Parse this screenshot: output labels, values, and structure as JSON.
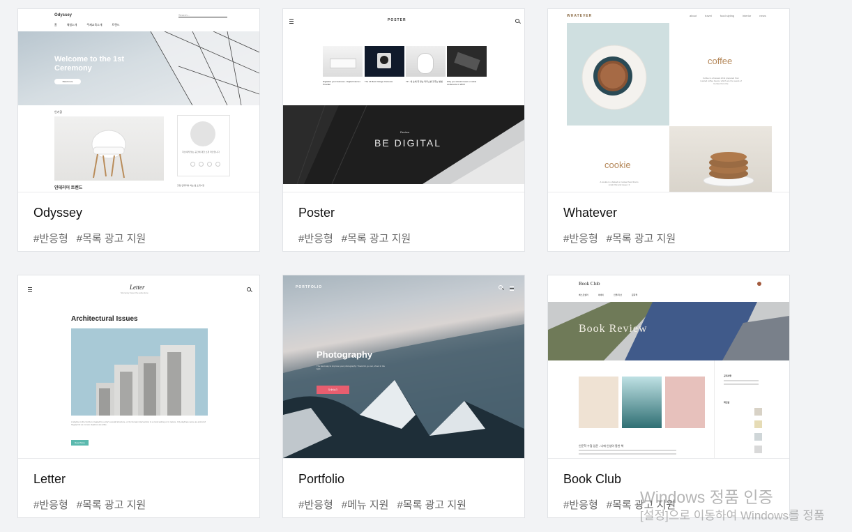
{
  "cards": [
    {
      "title": "Odyssey",
      "tags": [
        "#반응형",
        "#목록 광고 지원"
      ],
      "preview": {
        "logo": "Odyssey",
        "search_placeholder": "Search...",
        "nav": [
          "홈",
          "체험소개",
          "주제교육소개",
          "트렌드"
        ],
        "hero_title": "Welcome to the 1st Ceremony",
        "hero_button": "Read more",
        "section_label": "인기글",
        "post_title": "인테리어 트렌드",
        "side_text": "자신에게 맞는 공간에 대한 소개 라인입니다",
        "side_bottom": "힐링 인테리어 하는 법 소개 3장",
        "colors": {
          "hero": "#c9d2d9"
        }
      }
    },
    {
      "title": "Poster",
      "tags": [
        "#반응형",
        "#목록 광고 지원"
      ],
      "preview": {
        "logo": "POSTER",
        "items": [
          "Digitalize your business - Digital Internet Provider",
          "The 14 Best Vintage Cameras",
          "TP - 내 손에 꼭 맞는 마우스를 갖추는 방법",
          "Why you should invest a mobile conference in 2018"
        ],
        "banner_small": "Review",
        "banner_big": "BE DIGITAL"
      }
    },
    {
      "title": "Whatever",
      "tags": [
        "#반응형",
        "#목록 광고 지원"
      ],
      "preview": {
        "logo": "WHATEVER",
        "nav": [
          "about",
          "travel",
          "food styling",
          "interior",
          "news"
        ],
        "label_1": "coffee",
        "label_2": "cookie",
        "desc_1": "Coffee is a brewed drink prepared from roasted coffee beans, which are the seeds of berries from the",
        "desc_2": "A cookie is a baked or cooked food that is small, flat and sweet. It"
      }
    },
    {
      "title": "Letter",
      "tags": [
        "#반응형",
        "#목록 광고 지원"
      ],
      "preview": {
        "logo": "Letter",
        "tagline": "Sincerely travel the adventure",
        "heading": "Architectural Issues",
        "body": "A skyline is the horizon created by a city's overall structure, or by human intervention in a rural setting or in nature. City skylines serve as a kind of fingerprint as no two skylines are alike.",
        "button": "Read More"
      }
    },
    {
      "title": "Portfolio",
      "tags": [
        "#반응형",
        "#메뉴 지원",
        "#목록 광고 지원"
      ],
      "preview": {
        "logo": "PORTFOLIO",
        "heading": "Photography",
        "body": "The best way to improve your photography: Travel far, go out, shoot in the light",
        "button": "자세히보기"
      }
    },
    {
      "title": "Book Club",
      "tags": [
        "#반응형",
        "#목록 광고 지원"
      ],
      "preview": {
        "logo": "Book Club",
        "nav": [
          "베스트셀러",
          "에세이",
          "인물/자선",
          "문화책"
        ],
        "hero": "Book Review",
        "post_title": "인문학 수첩 입문 - 나에 인생이 통한 책",
        "sidebar_heading_1": "공지사항",
        "sidebar_heading_2": "최신글"
      }
    }
  ],
  "watermark": {
    "line1": "Windows 정품 인증",
    "line2": "[설정]으로 이동하여 Windows를 정품"
  }
}
